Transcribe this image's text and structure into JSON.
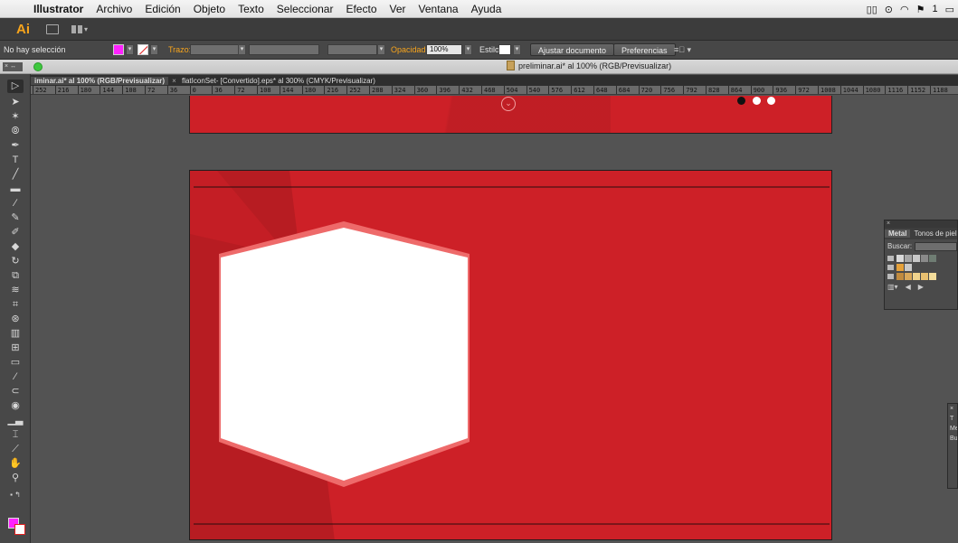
{
  "menubar": {
    "app_name": "Illustrator",
    "items": [
      "Archivo",
      "Edición",
      "Objeto",
      "Texto",
      "Seleccionar",
      "Efecto",
      "Ver",
      "Ventana",
      "Ayuda"
    ],
    "status_extra": "1"
  },
  "appbar": {
    "logo": "Ai"
  },
  "controlbar": {
    "selection": "No hay selección",
    "stroke_label": "Trazo:",
    "opacity_label": "Opacidad:",
    "opacity_value": "100%",
    "style_label": "Estilo:",
    "fit_button": "Ajustar documento",
    "prefs_button": "Preferencias",
    "fill_color": "#ff22ff"
  },
  "window": {
    "close_label": "×  ↔",
    "title": "preliminar.ai* al 100% (RGB/Previsualizar)"
  },
  "tabs": [
    {
      "label": "iminar.ai* al 100% (RGB/Previsualizar)"
    },
    {
      "close": "×",
      "label": "flatIconSet- [Convertido].eps* al 300% (CMYK/Previsualizar)"
    }
  ],
  "ruler": [
    "252",
    "216",
    "180",
    "144",
    "108",
    "72",
    "36",
    "0",
    "36",
    "72",
    "108",
    "144",
    "180",
    "216",
    "252",
    "288",
    "324",
    "360",
    "396",
    "432",
    "468",
    "504",
    "540",
    "576",
    "612",
    "648",
    "684",
    "720",
    "756",
    "792",
    "828",
    "864",
    "900",
    "936",
    "972",
    "1008",
    "1044",
    "1080",
    "1116",
    "1152",
    "1188"
  ],
  "artwork": {
    "background_color": "#cd2027",
    "hexagon_color": "#ffffff",
    "hexagon_stroke": "#f07070"
  },
  "swatch_panel": {
    "close": "×",
    "tabs": [
      "Metal",
      "Tonos de piel"
    ],
    "search_label": "Buscar:"
  },
  "mini_panel": {
    "lines": [
      "×",
      "T",
      "Me",
      "",
      "Bu"
    ]
  }
}
